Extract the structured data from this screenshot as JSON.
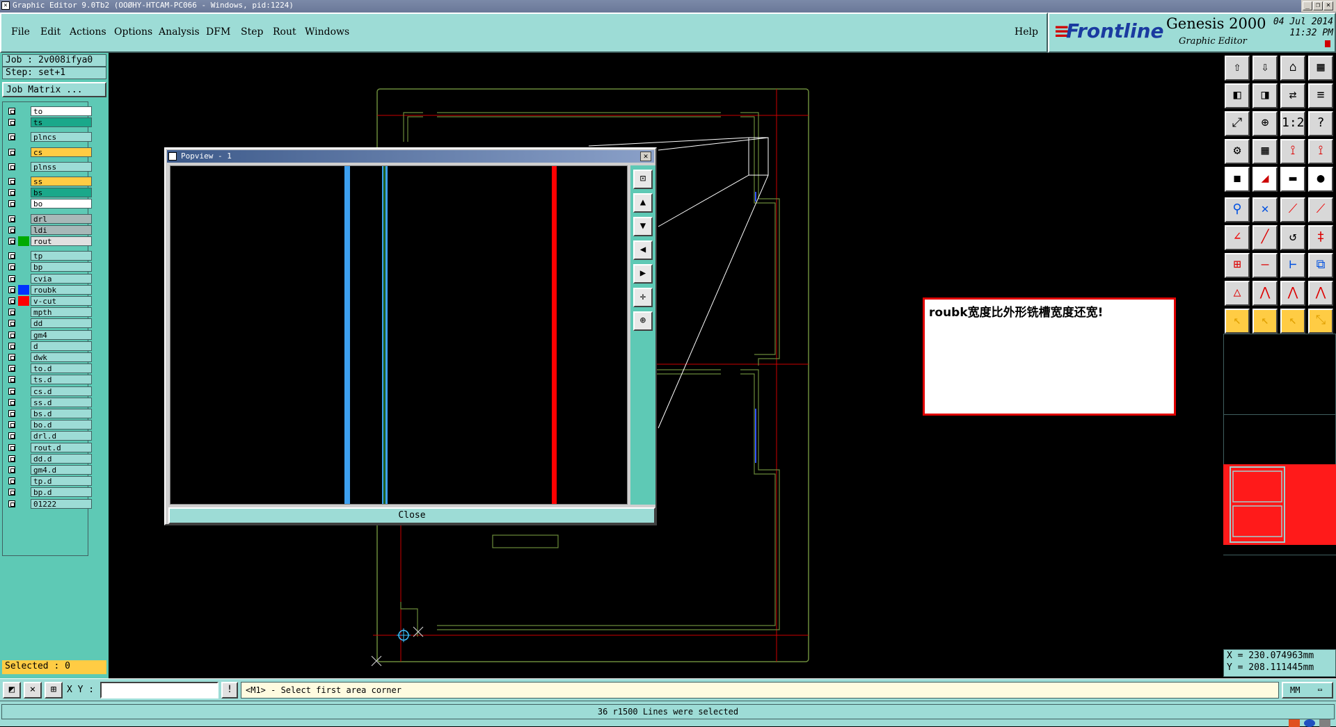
{
  "window": {
    "title": "Graphic Editor 9.0Tb2 (OOØHY-HTCAM-PC066 - Windows, pid:1224)"
  },
  "menu": [
    "File",
    "Edit",
    "Actions",
    "Options",
    "Analysis",
    "DFM",
    "Step",
    "Rout",
    "Windows"
  ],
  "help_label": "Help",
  "brand": {
    "logo": "Frontline",
    "product": "Genesis 2000",
    "subtitle": "Graphic Editor",
    "date": "04 Jul 2014",
    "time": "11:32 PM"
  },
  "job": {
    "job_label": "Job : 2v008ifya0",
    "step_label": "Step: set+1",
    "matrix_button": "Job Matrix ..."
  },
  "layers": [
    {
      "name": "to",
      "color": "#ffffff",
      "swatch": ""
    },
    {
      "name": "ts",
      "color": "#1aa88a",
      "swatch": ""
    },
    {
      "name": "plncs",
      "color": "#9ddcd6",
      "swatch": ""
    },
    {
      "name": "cs",
      "color": "#ffcc44",
      "swatch": ""
    },
    {
      "name": "plnss",
      "color": "#9ddcd6",
      "swatch": ""
    },
    {
      "name": "ss",
      "color": "#ffcc44",
      "swatch": ""
    },
    {
      "name": "bs",
      "color": "#1aa88a",
      "swatch": ""
    },
    {
      "name": "bo",
      "color": "#ffffff",
      "swatch": ""
    },
    {
      "name": "drl",
      "color": "#a8b8b8",
      "swatch": ""
    },
    {
      "name": "ldi",
      "color": "#a8b8b8",
      "swatch": ""
    },
    {
      "name": "rout",
      "color": "#e0e0e0",
      "swatch": "#00aa00"
    },
    {
      "name": "tp",
      "color": "#9ddcd6",
      "swatch": ""
    },
    {
      "name": "bp",
      "color": "#9ddcd6",
      "swatch": ""
    },
    {
      "name": "cvia",
      "color": "#9ddcd6",
      "swatch": ""
    },
    {
      "name": "roubk",
      "color": "#9ddcd6",
      "swatch": "#0033ff"
    },
    {
      "name": "v-cut",
      "color": "#9ddcd6",
      "swatch": "#ff0000"
    },
    {
      "name": "mpth",
      "color": "#9ddcd6",
      "swatch": ""
    },
    {
      "name": "dd",
      "color": "#9ddcd6",
      "swatch": ""
    },
    {
      "name": "gm4",
      "color": "#9ddcd6",
      "swatch": ""
    },
    {
      "name": "d",
      "color": "#9ddcd6",
      "swatch": ""
    },
    {
      "name": "dwk",
      "color": "#9ddcd6",
      "swatch": ""
    },
    {
      "name": "to.d",
      "color": "#9ddcd6",
      "swatch": ""
    },
    {
      "name": "ts.d",
      "color": "#9ddcd6",
      "swatch": ""
    },
    {
      "name": "cs.d",
      "color": "#9ddcd6",
      "swatch": ""
    },
    {
      "name": "ss.d",
      "color": "#9ddcd6",
      "swatch": ""
    },
    {
      "name": "bs.d",
      "color": "#9ddcd6",
      "swatch": ""
    },
    {
      "name": "bo.d",
      "color": "#9ddcd6",
      "swatch": ""
    },
    {
      "name": "drl.d",
      "color": "#9ddcd6",
      "swatch": ""
    },
    {
      "name": "rout.d",
      "color": "#9ddcd6",
      "swatch": ""
    },
    {
      "name": "dd.d",
      "color": "#9ddcd6",
      "swatch": ""
    },
    {
      "name": "gm4.d",
      "color": "#9ddcd6",
      "swatch": ""
    },
    {
      "name": "tp.d",
      "color": "#9ddcd6",
      "swatch": ""
    },
    {
      "name": "bp.d",
      "color": "#9ddcd6",
      "swatch": ""
    },
    {
      "name": "01222",
      "color": "#9ddcd6",
      "swatch": ""
    }
  ],
  "selected_label": "Selected : 0",
  "popview": {
    "title": "Popview - 1",
    "close_label": "Close"
  },
  "note": "roubk宽度比外形铣槽宽度还宽!",
  "coords": {
    "x": "X = 230.074963mm",
    "y": "Y = 208.111445mm"
  },
  "bottom": {
    "xy_label": "X Y :",
    "xy_value": "",
    "prompt": "<M1> - Select first area corner",
    "units": "MM"
  },
  "status": "36 r1500 Lines were selected",
  "colors": {
    "panel": "#9ddcd6",
    "panel_dark": "#5ec9b5",
    "outline": "#6a8a3a",
    "ref_line": "#cc0000",
    "accent": "#e00000"
  }
}
